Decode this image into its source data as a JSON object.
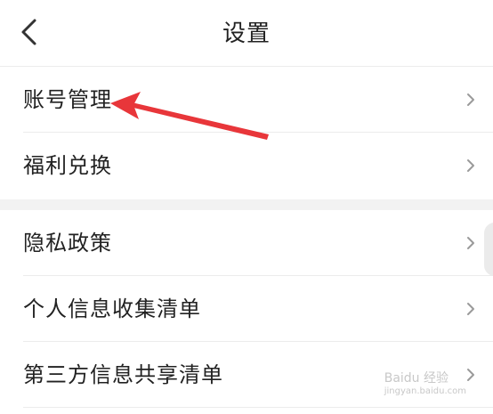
{
  "header": {
    "title": "设置"
  },
  "settings": {
    "group1": [
      {
        "label": "账号管理"
      },
      {
        "label": "福利兑换"
      }
    ],
    "group2": [
      {
        "label": "隐私政策"
      },
      {
        "label": "个人信息收集清单"
      },
      {
        "label": "第三方信息共享清单"
      }
    ]
  },
  "icons": {
    "back": "chevron-left-icon",
    "row_arrow": "chevron-right-icon"
  },
  "colors": {
    "annotation_arrow": "#e8363a",
    "text": "#222222",
    "chevron": "#9a9a9a",
    "divider": "#ececec",
    "group_gap": "#f2f2f2"
  },
  "watermark": {
    "text": "Baidu 经验",
    "sub": "jingyan.baidu.com"
  }
}
